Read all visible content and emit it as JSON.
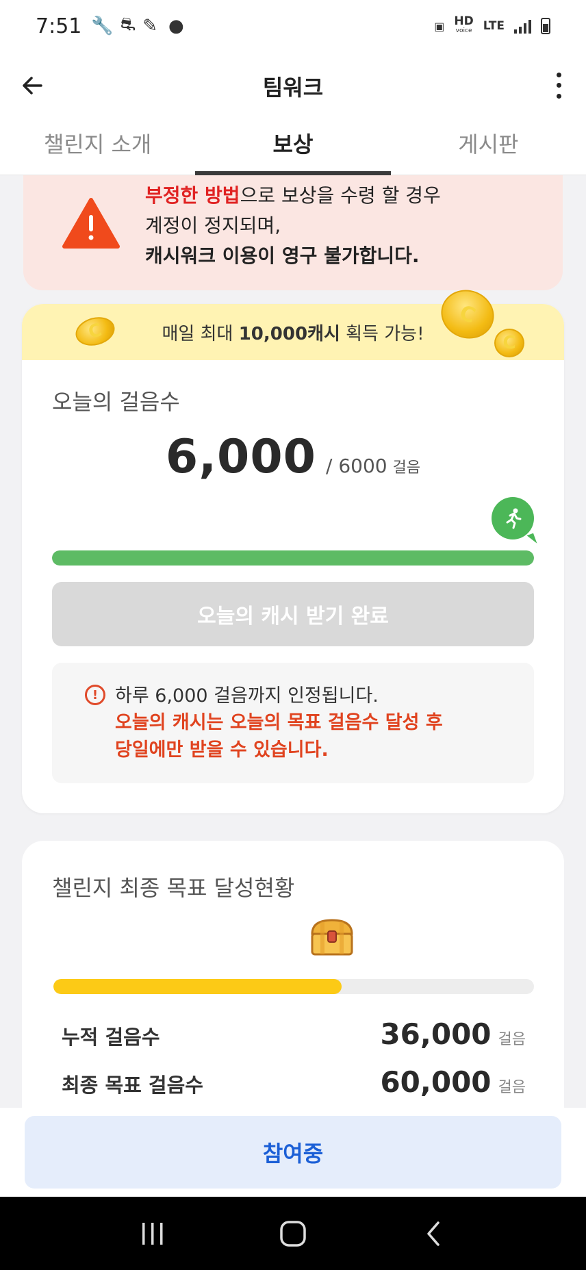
{
  "status_bar": {
    "time": "7:51",
    "network_top": "HD",
    "network_sub": "voice",
    "lte": "LTE"
  },
  "appbar": {
    "title": "팀워크"
  },
  "tabs": [
    {
      "label": "챌린지 소개",
      "active": false
    },
    {
      "label": "보상",
      "active": true
    },
    {
      "label": "게시판",
      "active": false
    }
  ],
  "warning": {
    "line1_red": "부정한 방법",
    "line1_rest": "으로 보상을 수령 할 경우",
    "line2": "계정이 정지되며,",
    "line3": "캐시워크 이용이 영구 불가합니다."
  },
  "promo": {
    "prefix": "매일 최대 ",
    "amount": "10,000캐시",
    "suffix": " 획득 가능!"
  },
  "today": {
    "label": "오늘의 걸음수",
    "steps": "6,000",
    "goal": "/ 6000",
    "unit": "걸음",
    "progress_fraction": 1.0,
    "claim_label": "오늘의 캐시 받기 완료"
  },
  "notice": {
    "line1": "하루 6,000 걸음까지 인정됩니다.",
    "line2": "오늘의 캐시는 오늘의 목표 걸음수 달성 후",
    "line3": "당일에만 받을 수 있습니다."
  },
  "challenge": {
    "title": "챌린지 최종 목표 달성현황",
    "progress_fraction": 0.6,
    "rows": [
      {
        "label": "누적 걸음수",
        "value": "36,000",
        "unit": "걸음"
      },
      {
        "label": "최종 목표 걸음수",
        "value": "60,000",
        "unit": "걸음"
      }
    ]
  },
  "cta": {
    "label": "참여중"
  },
  "colors": {
    "accent_red": "#e02222",
    "progress_green": "#5dbb64",
    "progress_yellow": "#fcca16",
    "cta_blue": "#1b5fd6"
  }
}
